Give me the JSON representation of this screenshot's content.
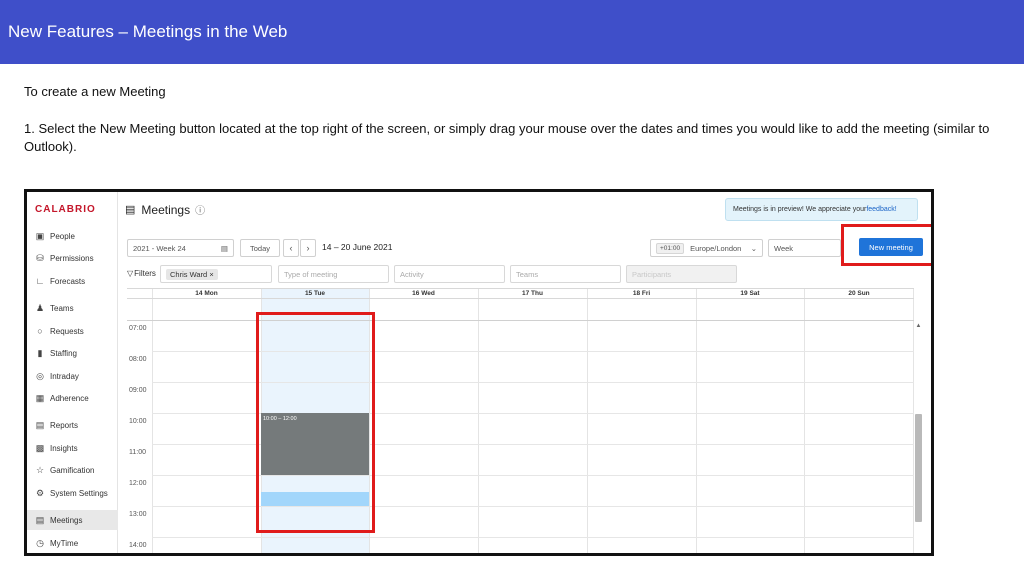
{
  "slide": {
    "title": "New Features – Meetings in the Web",
    "intro": "To create a new Meeting",
    "step": "1. Select the New Meeting button located at the top right of the screen, or simply drag your mouse over the dates and times you would like to add the meeting (similar to Outlook)."
  },
  "app": {
    "logo": "CALABRIO",
    "page_title": "Meetings",
    "banner": {
      "text": "Meetings is in preview! We appreciate your ",
      "link": "feedback!"
    },
    "sidebar": [
      {
        "label": "People",
        "icon": "people-icon"
      },
      {
        "label": "Permissions",
        "icon": "lock-icon"
      },
      {
        "label": "Forecasts",
        "icon": "forecast-icon"
      },
      {
        "label": "Teams",
        "icon": "teams-icon"
      },
      {
        "label": "Requests",
        "icon": "requests-icon"
      },
      {
        "label": "Staffing",
        "icon": "staffing-icon"
      },
      {
        "label": "Intraday",
        "icon": "intraday-icon"
      },
      {
        "label": "Adherence",
        "icon": "adherence-icon"
      },
      {
        "label": "Reports",
        "icon": "reports-icon"
      },
      {
        "label": "Insights",
        "icon": "insights-icon"
      },
      {
        "label": "Gamification",
        "icon": "trophy-icon"
      },
      {
        "label": "System Settings",
        "icon": "gear-icon"
      },
      {
        "label": "Meetings",
        "icon": "calendar-icon",
        "active": true
      },
      {
        "label": "MyTime",
        "icon": "clock-icon"
      }
    ],
    "toolbar": {
      "week": "2021 - Week 24",
      "today": "Today",
      "range": "14 – 20 June 2021",
      "tz_offset": "+01:00",
      "timezone": "Europe/London",
      "view": "Week",
      "new_meeting": "New meeting"
    },
    "filters": {
      "label": "Filters",
      "chip": "Chris Ward",
      "type_placeholder": "Type of meeting",
      "activity_placeholder": "Activity",
      "teams_placeholder": "Teams",
      "disabled_placeholder": "Participants"
    },
    "calendar": {
      "days": [
        "14 Mon",
        "15 Tue",
        "16 Wed",
        "17 Thu",
        "18 Fri",
        "19 Sat",
        "20 Sun"
      ],
      "selected_day": "15 Tue",
      "times": [
        "07:00",
        "08:00",
        "09:00",
        "10:00",
        "11:00",
        "12:00",
        "13:00",
        "14:00"
      ],
      "event": {
        "label": "10:00 – 12:00",
        "color": "#757a7b"
      }
    }
  }
}
